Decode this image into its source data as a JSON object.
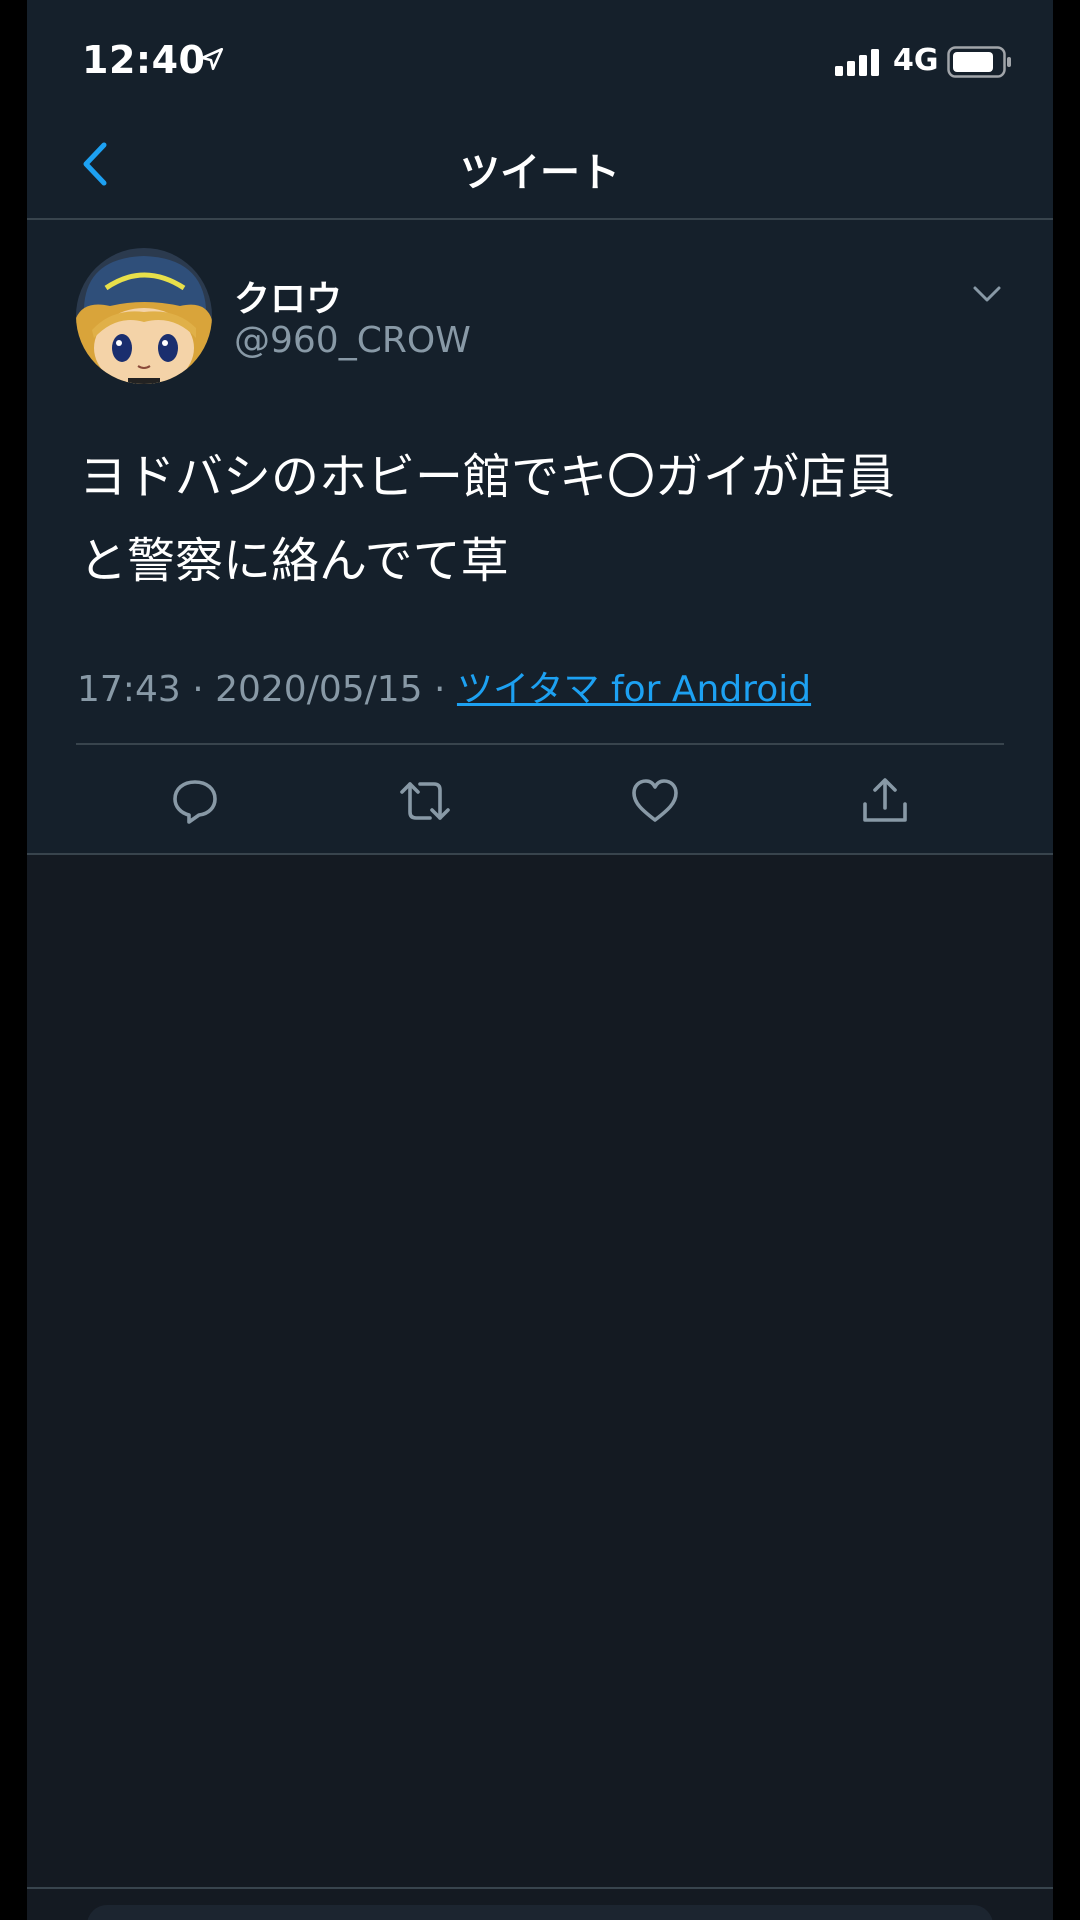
{
  "status_bar": {
    "time": "12:40",
    "network": "4G"
  },
  "nav": {
    "title": "ツイート"
  },
  "tweet": {
    "display_name": "クロウ",
    "handle": "@960_CROW",
    "text_line1": "ヨドバシのホビー館でキ〇ガイが店員",
    "text_line2": "と警察に絡んでて草",
    "time": "17:43",
    "date": "2020/05/15",
    "separator": " · ",
    "source": "ツイタマ for Android"
  },
  "icons": {
    "back": "chevron-left-icon",
    "more": "chevron-down-icon",
    "reply": "reply-icon",
    "retweet": "retweet-icon",
    "like": "heart-icon",
    "share": "share-icon"
  },
  "colors": {
    "background": "#15202b",
    "empty_area": "#141a22",
    "accent": "#1da1f2",
    "secondary_text": "#8899a6",
    "divider": "#38444d"
  }
}
